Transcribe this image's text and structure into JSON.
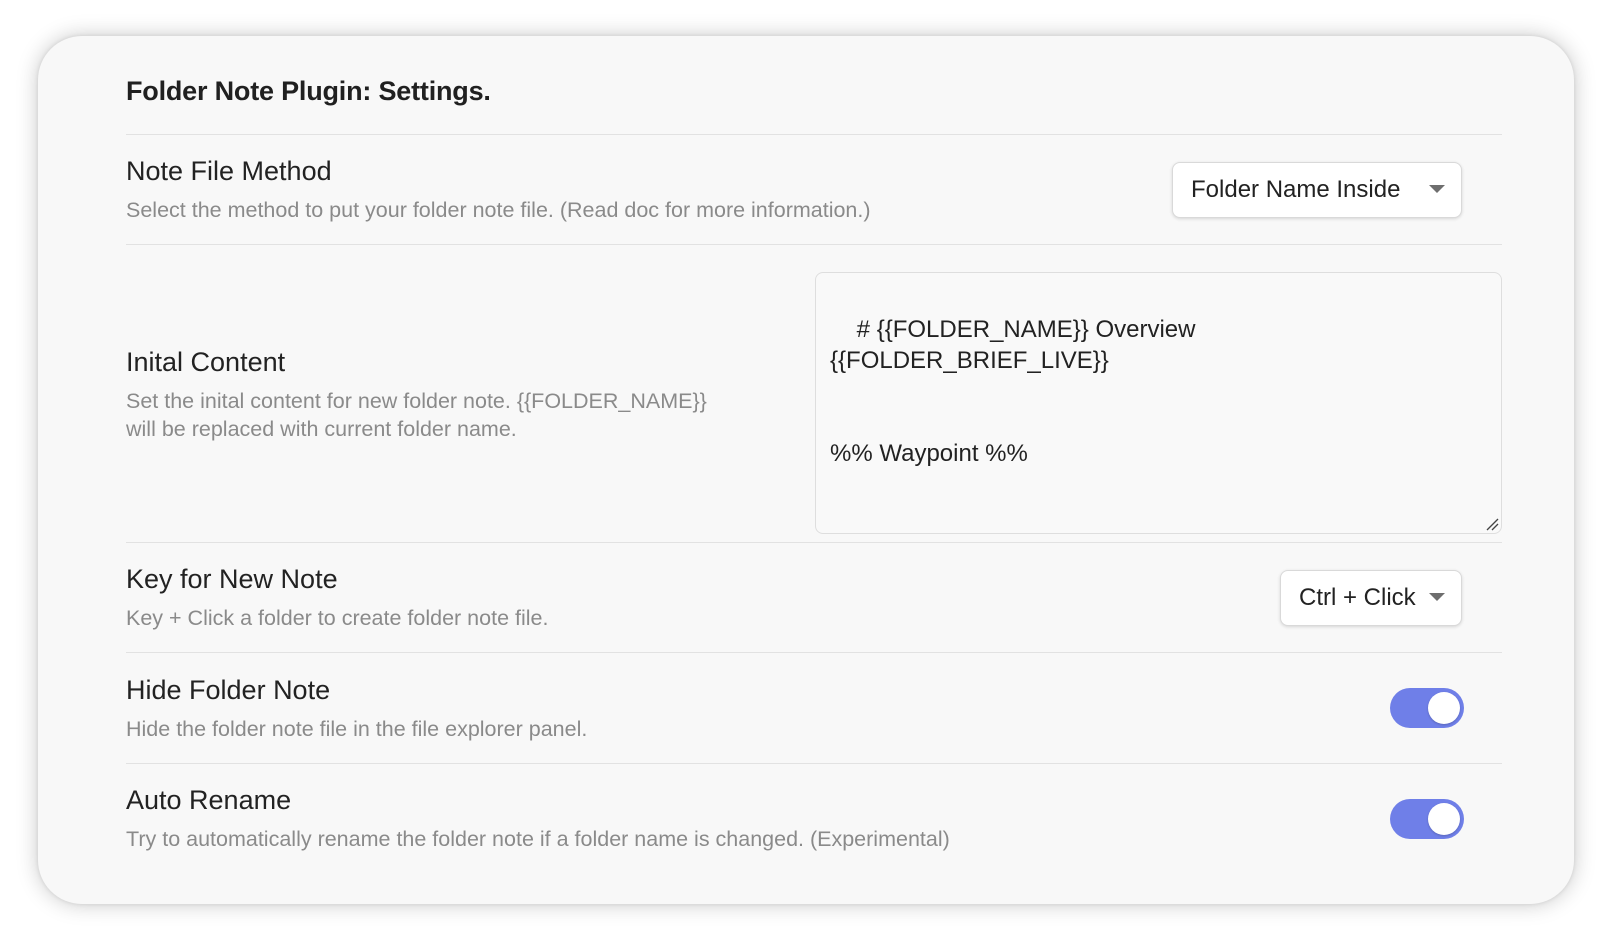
{
  "page": {
    "title": "Folder Note Plugin: Settings."
  },
  "settings": {
    "note_file_method": {
      "name": "Note File Method",
      "description": "Select the method to put your folder note file. (Read doc for more information.)",
      "selected_value": "Folder Name Inside"
    },
    "initial_content": {
      "name": "Inital Content",
      "description_line1": "Set the inital content for new folder note. {{FOLDER_NAME}}",
      "description_line2": "will be replaced with current folder name.",
      "value": "# {{FOLDER_NAME}} Overview\n{{FOLDER_BRIEF_LIVE}}\n\n\n%% Waypoint %%"
    },
    "key_for_new_note": {
      "name": "Key for New Note",
      "description": "Key + Click a folder to create folder note file.",
      "selected_value": "Ctrl + Click"
    },
    "hide_folder_note": {
      "name": "Hide Folder Note",
      "description": "Hide the folder note file in the file explorer panel.",
      "enabled": true
    },
    "auto_rename": {
      "name": "Auto Rename",
      "description": "Try to automatically rename the folder note if a folder name is changed. (Experimental)",
      "enabled": true
    }
  },
  "colors": {
    "toggle_on": "#6f7fe8",
    "card_background": "#f8f8f8"
  },
  "icons": {
    "dropdown_caret": "chevron-down-icon",
    "resize_handle": "resize-grip-icon"
  }
}
